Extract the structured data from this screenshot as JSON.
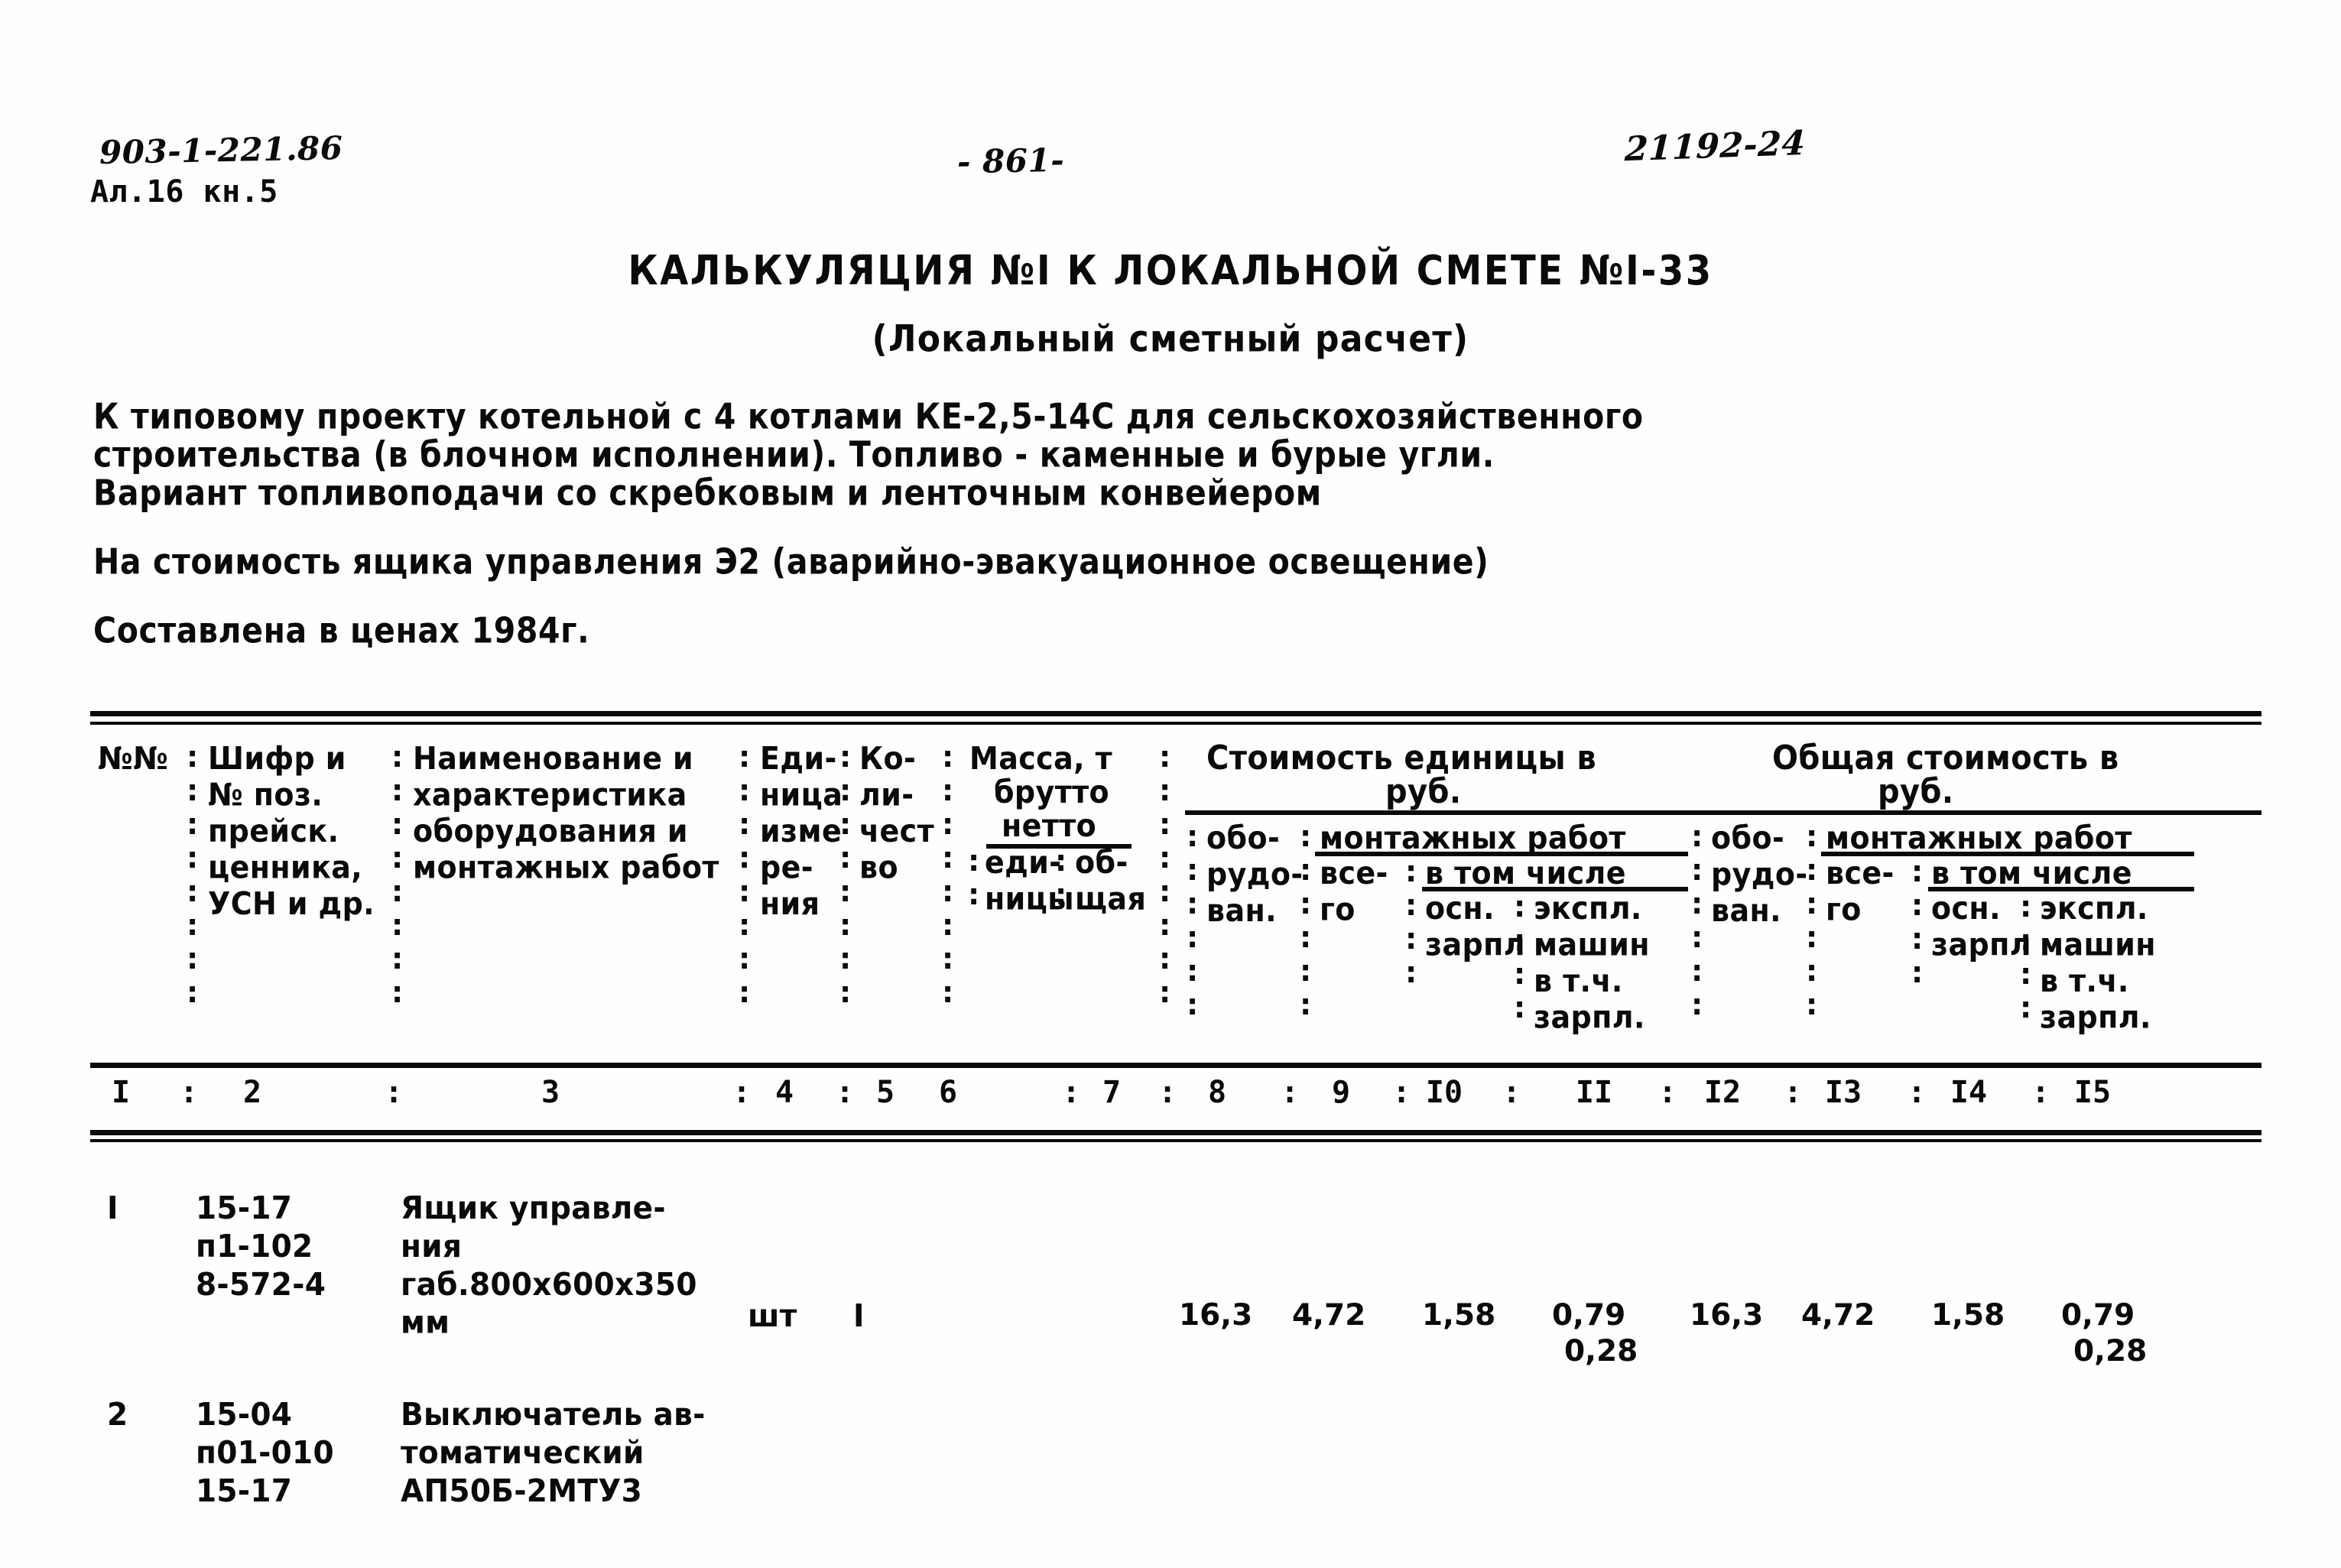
{
  "header": {
    "doc_code": "903-1-221.86",
    "album_line": "Ал.16 кн.5",
    "page_number": "- 861-",
    "sheet_code": "21192-24"
  },
  "title": {
    "main": "КАЛЬКУЛЯЦИЯ №I К ЛОКАЛЬНОЙ СМЕТЕ №I-33",
    "sub": "(Локальный сметный расчет)"
  },
  "description": {
    "line1": "К типовому проекту котельной с 4 котлами КЕ-2,5-14С для сельскохозяйственного",
    "line2": "строительства (в блочном исполнении). Топливо - каменные и бурые угли.",
    "line3": "Вариант топливоподачи со скребковым и ленточным конвейером",
    "scope": "На стоимость ящика управления Э2 (аварийно-эвакуационное освещение)",
    "prices": "Составлена в ценах 1984г."
  },
  "table": {
    "headers": {
      "num_col": "№№",
      "code_col": "Шифр и\n№ поз.\nпрейск.\nценника,\nУСН и др.",
      "name_col": "Наименование и\nхарактеристика\nоборудования и\nмонтажных работ",
      "unit_col": "Еди-\nница\nизме\nре-\nния",
      "qty_col": "Ко-\nли-\nчест\nво",
      "mass_title": "Масса, т",
      "mass_brutto": "брутто",
      "mass_netto": "нетто",
      "mass_unit": "еди-\nницы",
      "mass_total": "об-\nщая",
      "unit_cost_title": "Стоимость единицы в",
      "unit_cost_rub": "руб.",
      "total_cost_title": "Общая стоимость в",
      "total_cost_rub": "руб.",
      "equip_1": "обо-\nрудо-\nван.",
      "install_1": "монтажных работ",
      "install_all_1": "все-\nго",
      "in_which_1": "в том числе",
      "osn_1": "осн.\nзарпл",
      "expl_1": "экспл.\nмашин\nв т.ч.\nзарпл.",
      "equip_2": "обо-\nрудо-\nван.",
      "install_2": "монтажных работ",
      "install_all_2": "все-\nго",
      "in_which_2": "в том числе",
      "osn_2": "осн.\nзарпл",
      "expl_2": "экспл.\nмашин\nв т.ч.\nзарпл."
    },
    "column_numbers": [
      "I",
      "2",
      "3",
      "4",
      "5",
      "6",
      "7",
      "8",
      "9",
      "I0",
      "II",
      "I2",
      "I3",
      "I4",
      "I5"
    ],
    "rows": [
      {
        "no": "I",
        "code": "15-17\nп1-102\n8-572-4",
        "name": "Ящик управле-\nния\nгаб.800х600х350\nмм",
        "unit": "шт",
        "qty": "I",
        "mass_unit": "",
        "mass_total": "",
        "unit_equip": "16,3",
        "unit_install_all": "4,72",
        "unit_osn": "1,58",
        "unit_expl": "0,79",
        "unit_expl_zarpl": "0,28",
        "total_equip": "16,3",
        "total_install_all": "4,72",
        "total_osn": "1,58",
        "total_expl": "0,79",
        "total_expl_zarpl": "0,28"
      },
      {
        "no": "2",
        "code": "15-04\nп01-010\n15-17",
        "name": "Выключатель ав-\nтоматический\nАП50Б-2МТУ3",
        "unit": "",
        "qty": "",
        "mass_unit": "",
        "mass_total": "",
        "unit_equip": "",
        "unit_install_all": "",
        "unit_osn": "",
        "unit_expl": "",
        "unit_expl_zarpl": "",
        "total_equip": "",
        "total_install_all": "",
        "total_osn": "",
        "total_expl": "",
        "total_expl_zarpl": ""
      }
    ]
  },
  "colors": {
    "ink": "#0a0a0a",
    "paper": "#fefefe"
  }
}
